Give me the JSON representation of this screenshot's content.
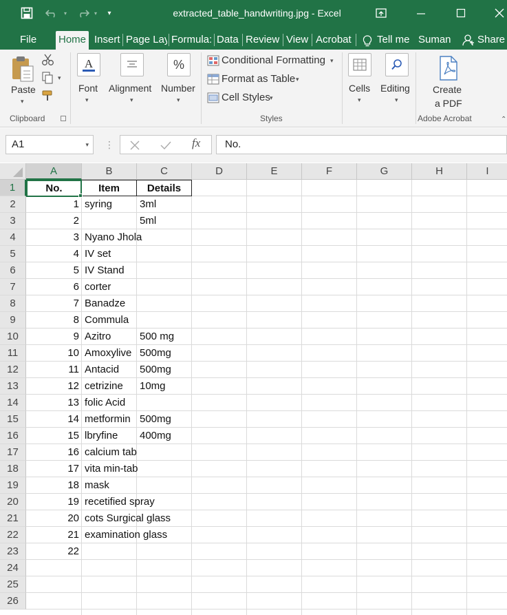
{
  "window": {
    "title": "extracted_table_handwriting.jpg - Excel",
    "colors": {
      "brand": "#217346",
      "ribbon": "#f3f3f3"
    }
  },
  "tabs": [
    {
      "label": "File"
    },
    {
      "label": "Home"
    },
    {
      "label": "Insert"
    },
    {
      "label": "Page Lay"
    },
    {
      "label": "Formula:"
    },
    {
      "label": "Data"
    },
    {
      "label": "Review"
    },
    {
      "label": "View"
    },
    {
      "label": "Acrobat"
    },
    {
      "label": "Tell me"
    },
    {
      "label": "Suman"
    },
    {
      "label": "Share"
    }
  ],
  "ribbon": {
    "paste": "Paste",
    "clipboard": "Clipboard",
    "font": "Font",
    "alignment": "Alignment",
    "number": "Number",
    "conditional_formatting": "Conditional Formatting",
    "format_as_table": "Format as Table",
    "cell_styles": "Cell Styles",
    "styles": "Styles",
    "cells": "Cells",
    "editing": "Editing",
    "create_pdf_1": "Create",
    "create_pdf_2": "a PDF",
    "adobe_acrobat": "Adobe Acrobat"
  },
  "formula_bar": {
    "name_box": "A1",
    "fx": "fx",
    "formula": "No."
  },
  "sheet": {
    "columns": [
      "A",
      "B",
      "C",
      "D",
      "E",
      "F",
      "G",
      "H",
      "I"
    ],
    "rows": [
      "1",
      "2",
      "3",
      "4",
      "5",
      "6",
      "7",
      "8",
      "9",
      "10",
      "11",
      "12",
      "13",
      "14",
      "15",
      "16",
      "17",
      "18",
      "19",
      "20",
      "21",
      "22",
      "23",
      "24",
      "25",
      "26"
    ],
    "header": {
      "no": "No.",
      "item": "Item",
      "details": "Details"
    },
    "data": [
      {
        "no": "1",
        "item": "syring",
        "details": "3ml"
      },
      {
        "no": "2",
        "item": "",
        "details": "5ml"
      },
      {
        "no": "3",
        "item": "Nyano Jhola",
        "details": ""
      },
      {
        "no": "4",
        "item": "IV set",
        "details": ""
      },
      {
        "no": "5",
        "item": "IV Stand",
        "details": ""
      },
      {
        "no": "6",
        "item": "corter",
        "details": ""
      },
      {
        "no": "7",
        "item": "Banadze",
        "details": ""
      },
      {
        "no": "8",
        "item": "Commula",
        "details": ""
      },
      {
        "no": "9",
        "item": "Azitro",
        "details": "500 mg"
      },
      {
        "no": "10",
        "item": "Amoxylive",
        "details": "500mg"
      },
      {
        "no": "11",
        "item": "Antacid",
        "details": "500mg"
      },
      {
        "no": "12",
        "item": "cetrizine",
        "details": "10mg"
      },
      {
        "no": "13",
        "item": "folic Acid",
        "details": ""
      },
      {
        "no": "14",
        "item": "metformin",
        "details": "500mg"
      },
      {
        "no": "15",
        "item": "lbryfine",
        "details": "400mg"
      },
      {
        "no": "16",
        "item": "calcium tab",
        "details": ""
      },
      {
        "no": "17",
        "item": "vita min-tab",
        "details": ""
      },
      {
        "no": "18",
        "item": "mask",
        "details": ""
      },
      {
        "no": "19",
        "item": "recetified spray",
        "details": ""
      },
      {
        "no": "20",
        "item": "cots Surgical glass",
        "details": ""
      },
      {
        "no": "21",
        "item": "examination glass",
        "details": ""
      },
      {
        "no": "22",
        "item": "",
        "details": ""
      }
    ]
  }
}
